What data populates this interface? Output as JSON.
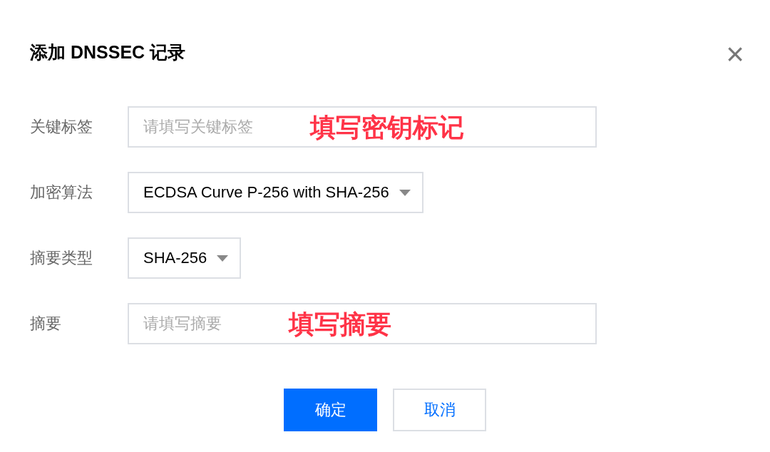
{
  "dialog": {
    "title": "添加 DNSSEC 记录",
    "close": "×"
  },
  "fields": [
    {
      "kind": "input",
      "label": "关键标签",
      "placeholder": "请填写关键标签",
      "annotation": "填写密钥标记"
    },
    {
      "kind": "select",
      "label": "加密算法",
      "value": "ECDSA Curve P-256 with SHA-256"
    },
    {
      "kind": "select",
      "label": "摘要类型",
      "value": "SHA-256"
    },
    {
      "kind": "input",
      "label": "摘要",
      "placeholder": "请填写摘要",
      "annotation": "填写摘要"
    }
  ],
  "buttons": [
    {
      "label": "确定",
      "primary": true
    },
    {
      "label": "取消",
      "primary": false
    }
  ]
}
